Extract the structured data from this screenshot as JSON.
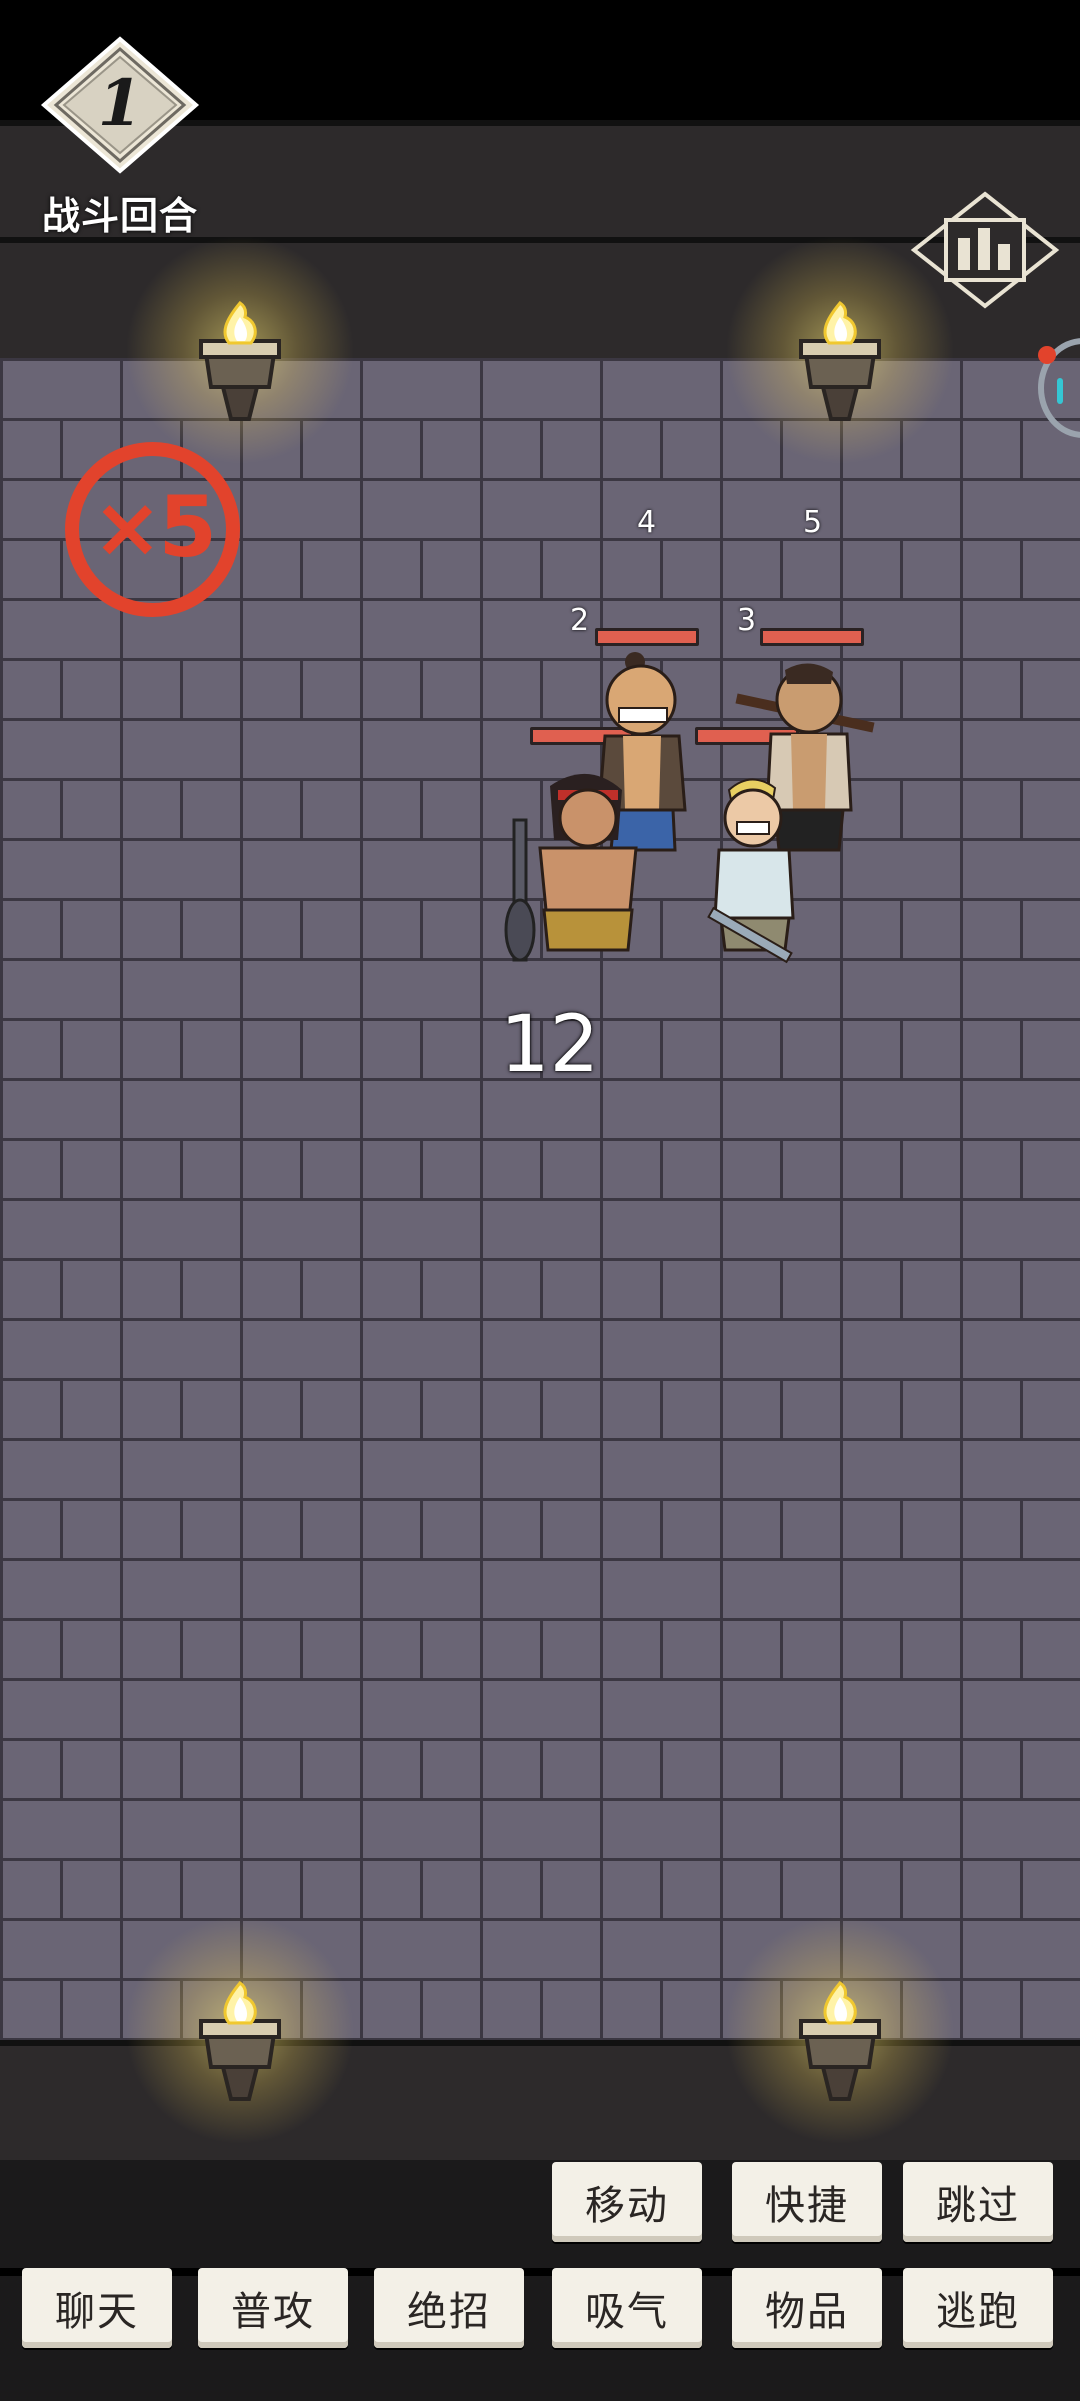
{
  "round": {
    "number": "1",
    "label": "战斗回合"
  },
  "speed": {
    "label": "×5"
  },
  "grid_numbers": [
    "4",
    "5",
    "2",
    "3"
  ],
  "turn_counter": "12",
  "actions_row1": [
    "移动",
    "快捷",
    "跳过"
  ],
  "actions_row2": [
    "聊天",
    "普攻",
    "绝招",
    "吸气",
    "物品",
    "逃跑"
  ],
  "colors": {
    "hp": "#e06050",
    "speed_ring": "#e2432c",
    "floor": "#6a6575",
    "button": "#f3f0e7"
  },
  "icons": [
    "stats-icon",
    "torch-icon"
  ]
}
